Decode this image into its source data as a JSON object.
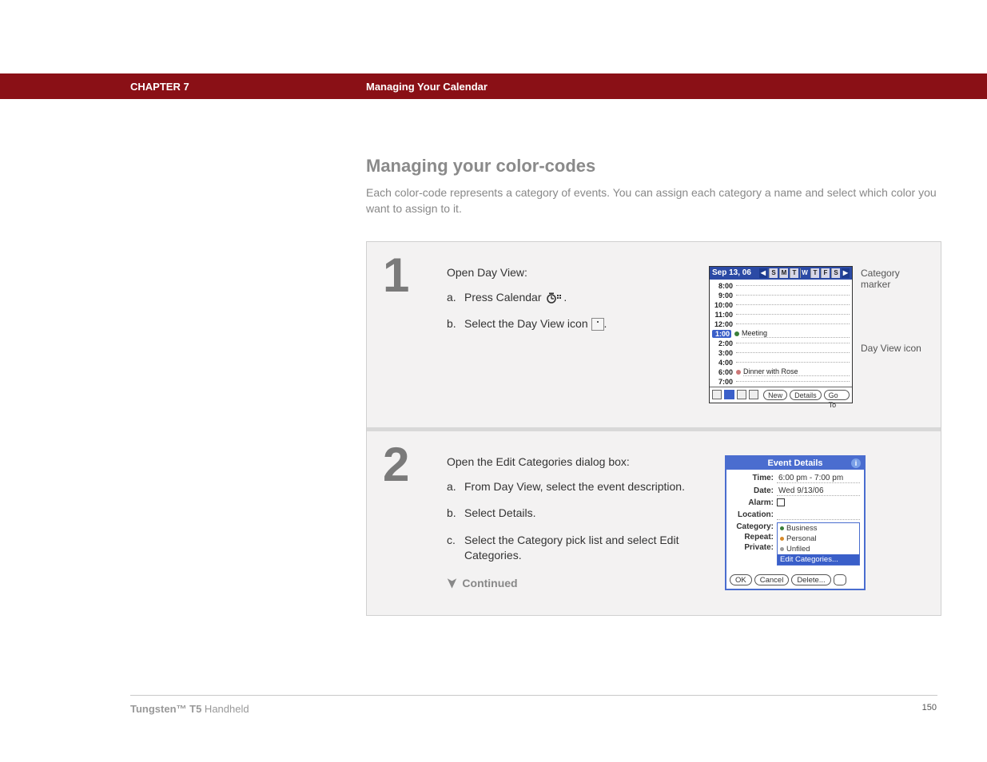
{
  "header": {
    "chapter": "CHAPTER 7",
    "title": "Managing Your Calendar"
  },
  "section": {
    "title": "Managing your color-codes",
    "description": "Each color-code represents a category of events. You can assign each category a name and select which color you want to assign to it."
  },
  "steps": [
    {
      "num": "1",
      "intro": "Open Day View:",
      "items": [
        {
          "lbl": "a.",
          "text_pre": "Press Calendar ",
          "text_post": "."
        },
        {
          "lbl": "b.",
          "text_pre": "Select the Day View icon ",
          "text_post": "."
        }
      ],
      "callouts": {
        "category_marker": "Category marker",
        "day_view_icon": "Day View icon"
      },
      "dayview": {
        "date": "Sep 13, 06",
        "days": [
          "S",
          "M",
          "T",
          "W",
          "T",
          "F",
          "S"
        ],
        "active_day_index": 3,
        "hours": [
          "8:00",
          "9:00",
          "10:00",
          "11:00",
          "12:00",
          "1:00",
          "2:00",
          "3:00",
          "4:00",
          "6:00",
          "7:00"
        ],
        "events": {
          "1:00": "Meeting",
          "6:00": "Dinner with Rose"
        },
        "highlight_hour": "1:00",
        "toolbar_buttons": [
          "New",
          "Details",
          "Go To"
        ]
      }
    },
    {
      "num": "2",
      "intro": "Open the Edit Categories dialog box:",
      "items": [
        {
          "lbl": "a.",
          "text": "From Day View, select the event description."
        },
        {
          "lbl": "b.",
          "text": "Select Details."
        },
        {
          "lbl": "c.",
          "text": "Select the Category pick list and select Edit Categories."
        }
      ],
      "continued": "Continued",
      "event_details": {
        "title": "Event Details",
        "rows": {
          "time_label": "Time:",
          "time_value": "6:00 pm - 7:00 pm",
          "date_label": "Date:",
          "date_value": "Wed 9/13/06",
          "alarm_label": "Alarm:",
          "location_label": "Location:",
          "category_label": "Category:",
          "repeat_label": "Repeat:",
          "private_label": "Private:"
        },
        "pick_options": [
          "Business",
          "Personal",
          "Unfiled",
          "Edit Categories..."
        ],
        "pick_highlight_index": 3,
        "buttons": [
          "OK",
          "Cancel",
          "Delete..."
        ]
      }
    }
  ],
  "footer": {
    "product_bold": "Tungsten™ T5",
    "product_light": " Handheld",
    "page": "150"
  }
}
